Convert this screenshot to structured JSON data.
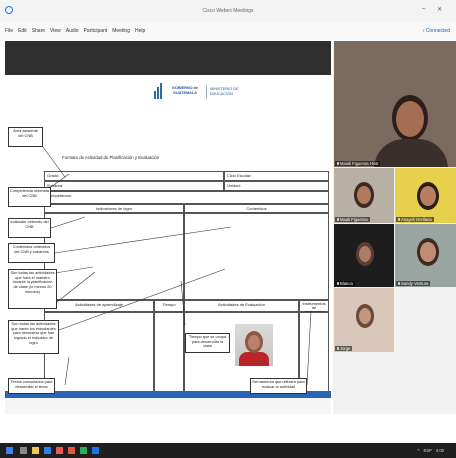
{
  "window": {
    "title": "Cisco Webex Meetings"
  },
  "menu": {
    "items": [
      "File",
      "Edit",
      "Share",
      "View",
      "Audio",
      "Participant",
      "Meeting",
      "Help"
    ],
    "connected": "Connected"
  },
  "doc": {
    "gov_title": "GOBIERNO de GUATEMALA",
    "ministry": "MINISTERIO DE EDUCACIÓN",
    "form_title": "Formato de Actividad de Planificación y Evaluación",
    "fields": {
      "grado": "Grado:",
      "ciclo": "Ciclo Escolar:",
      "subarea": "Subárea:",
      "unidad": "Unidad:",
      "competencia": "Competencia:",
      "indicadores": "Indicadores de logro",
      "contenidos": "Contenidos",
      "actividades": "Actividades de aprendizaje",
      "tiempo": "Tiempo",
      "eval_activities": "Actividades de Evaluación",
      "instrumentos": "Instrumentos de evaluación",
      "referencias": "Referencias"
    },
    "callouts": {
      "area": "Área asistente del CNB",
      "competencia": "Competencia obtenida del CNB",
      "indicador": "Indicador obtenido del CNB",
      "contenidos": "Contenidos obtenidos del CNB y subáreas",
      "actividades_1": "Son todas las actividades que hará el maestro durante la planificación de clase (lo menos 20 minutos)",
      "actividades_2": "Son todas las actividades que harán los estudiantes para demostrar que han logrado el indicador de logro",
      "tiempo": "Tiempo que se ocupa para desarrollar la clase",
      "textos": "Textos consultados para desarrollar el tema",
      "herramienta": "Herramienta que utilizará para evaluar la actividad"
    }
  },
  "participants": [
    {
      "name": "Maiali Figueroa",
      "role": "Host"
    },
    {
      "name": "Maali Figueroa",
      "role": ""
    },
    {
      "name": "Anayeli Orellana",
      "role": ""
    },
    {
      "name": "Blanca",
      "role": ""
    },
    {
      "name": "Sandy Ventura",
      "role": ""
    },
    {
      "name": "Jorge",
      "role": ""
    }
  ],
  "taskbar": {
    "lang": "ESP",
    "time": "4:00"
  },
  "colors": {
    "accent_blue": "#2a64b6",
    "share_band": "#2e2e2e",
    "taskbar": "#1f1f1f"
  }
}
